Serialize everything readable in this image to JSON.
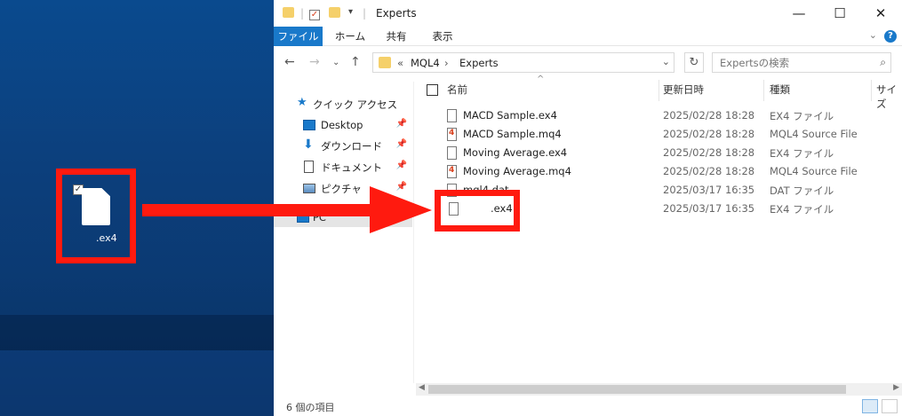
{
  "desktop": {
    "file_label": ".ex4"
  },
  "explorer": {
    "title": "Experts",
    "window_controls": {
      "minimize": "—",
      "maximize": "☐",
      "close": "✕"
    },
    "ribbon_tabs": [
      {
        "label": "ファイル",
        "active": true
      },
      {
        "label": "ホーム",
        "active": false
      },
      {
        "label": "共有",
        "active": false
      },
      {
        "label": "表示",
        "active": false
      }
    ],
    "address": {
      "overflow": "«",
      "crumbs": [
        "MQL4",
        "Experts"
      ],
      "separator": "›"
    },
    "search": {
      "placeholder": "Expertsの検索"
    },
    "nav_pane": {
      "quick_access": "クイック アクセス",
      "items": [
        {
          "label": "Desktop",
          "icon": "desktop-icon"
        },
        {
          "label": "ダウンロード",
          "icon": "download-icon"
        },
        {
          "label": "ドキュメント",
          "icon": "document-icon"
        },
        {
          "label": "ピクチャ",
          "icon": "picture-icon"
        }
      ],
      "pc": "PC"
    },
    "columns": {
      "name": "名前",
      "modified": "更新日時",
      "type": "種類",
      "size": "サイズ"
    },
    "files": [
      {
        "name": "MACD Sample.ex4",
        "date": "2025/02/28 18:28",
        "type": "EX4 ファイル",
        "kind": "ex4"
      },
      {
        "name": "MACD Sample.mq4",
        "date": "2025/02/28 18:28",
        "type": "MQL4 Source File",
        "kind": "mq4"
      },
      {
        "name": "Moving Average.ex4",
        "date": "2025/02/28 18:28",
        "type": "EX4 ファイル",
        "kind": "ex4"
      },
      {
        "name": "Moving Average.mq4",
        "date": "2025/02/28 18:28",
        "type": "MQL4 Source File",
        "kind": "mq4"
      },
      {
        "name": "mql4.dat",
        "date": "2025/03/17 16:35",
        "type": "DAT ファイル",
        "kind": "dat"
      },
      {
        "name": ".ex4",
        "date": "2025/03/17 16:35",
        "type": "EX4 ファイル",
        "kind": "ex4"
      }
    ],
    "status": "6 個の項目"
  },
  "colors": {
    "accent": "#1979ca",
    "annotation_red": "#ff1a0f",
    "folder_yellow": "#f5d06a"
  }
}
